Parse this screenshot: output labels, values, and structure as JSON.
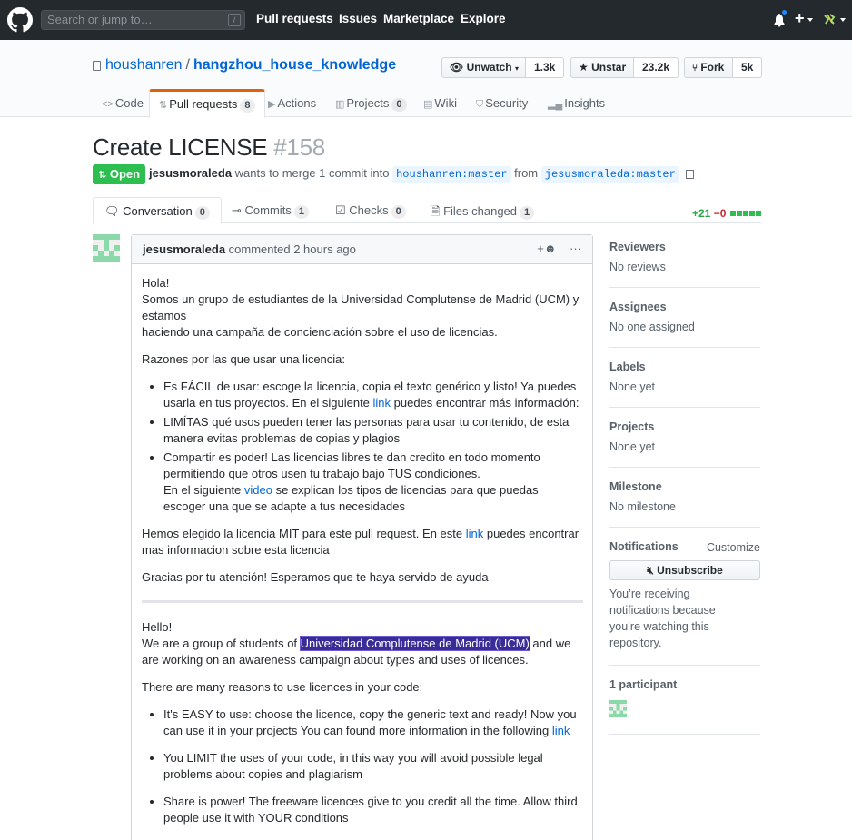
{
  "header": {
    "search_placeholder": "Search or jump to…",
    "search_key": "/",
    "nav": [
      "Pull requests",
      "Issues",
      "Marketplace",
      "Explore"
    ]
  },
  "repo": {
    "owner": "houshanren",
    "name": "hangzhou_house_knowledge",
    "watch_label": "Unwatch",
    "watch_count": "1.3k",
    "star_label": "Unstar",
    "star_count": "23.2k",
    "fork_label": "Fork",
    "fork_count": "5k",
    "tabs": [
      {
        "label": "Code",
        "icon": "code-icon"
      },
      {
        "label": "Pull requests",
        "count": "8",
        "icon": "pull-request-icon"
      },
      {
        "label": "Actions",
        "icon": "play-icon"
      },
      {
        "label": "Projects",
        "count": "0",
        "icon": "project-icon"
      },
      {
        "label": "Wiki",
        "icon": "book-icon"
      },
      {
        "label": "Security",
        "icon": "shield-icon"
      },
      {
        "label": "Insights",
        "icon": "graph-icon"
      }
    ]
  },
  "pr": {
    "title": "Create LICENSE",
    "number": "#158",
    "state": "Open",
    "author": "jesusmoraleda",
    "merge_text": "wants to merge 1 commit into",
    "base_branch": "houshanren:master",
    "from_text": "from",
    "head_branch": "jesusmoraleda:master",
    "tabs": [
      {
        "label": "Conversation",
        "count": "0"
      },
      {
        "label": "Commits",
        "count": "1"
      },
      {
        "label": "Checks",
        "count": "0"
      },
      {
        "label": "Files changed",
        "count": "1"
      }
    ],
    "additions": "+21",
    "deletions": "−0"
  },
  "comment": {
    "author": "jesusmoraleda",
    "action": "commented",
    "time": "2 hours ago",
    "es": {
      "greeting": "Hola!",
      "intro_1": "Somos un grupo de estudiantes de la Universidad Complutense de Madrid (UCM) y estamos",
      "intro_2": "haciendo una campaña de concienciación sobre el uso de licencias.",
      "reasons_title": "Razones por las que usar una licencia:",
      "b1_pre": "Es FÁCIL de usar: escoge la licencia, copia el texto genérico y listo! Ya puedes usarla en tus proyectos. En el siguiente ",
      "b1_link": "link",
      "b1_post": " puedes encontrar más información:",
      "b2": "LIMÍTAS qué usos pueden tener las personas para usar tu contenido, de esta manera evitas problemas de copias y plagios",
      "b3_1": "Compartir es poder! Las licencias libres te dan credito en todo momento permitiendo que otros usen tu trabajo bajo TUS condiciones.",
      "b3_pre": "En el siguiente ",
      "b3_link": "video",
      "b3_post": " se explican los tipos de licencias para que puedas escoger una que se adapte a tus necesidades",
      "mit_pre": "Hemos elegido la licencia MIT para este pull request. En este ",
      "mit_link": "link",
      "mit_post": " puedes encontrar mas informacion sobre esta licencia",
      "thanks": "Gracias por tu atención! Esperamos que te haya servido de ayuda"
    },
    "en": {
      "greeting": "Hello!",
      "intro_pre": "We are a group of students of ",
      "intro_hl": "Universidad Complutense de Madrid (UCM)",
      "intro_post": " and we are working on an awareness campaign about types and uses of licences.",
      "reasons_title": "There are many reasons to use licences in your code:",
      "b1_pre": "It's EASY to use: choose the licence, copy the generic text and ready! Now you can use it in your projects You can found more information in the following ",
      "b1_link": "link",
      "b2": "You LIMIT the uses of your code, in this way you will avoid possible legal problems about copies and plagiarism",
      "b3": "Share is power! The freeware licences give to you credit all the time. Allow third people use it with YOUR conditions"
    }
  },
  "sidebar": {
    "reviewers_title": "Reviewers",
    "reviewers_value": "No reviews",
    "assignees_title": "Assignees",
    "assignees_value": "No one assigned",
    "labels_title": "Labels",
    "labels_value": "None yet",
    "projects_title": "Projects",
    "projects_value": "None yet",
    "milestone_title": "Milestone",
    "milestone_value": "No milestone",
    "notifications_title": "Notifications",
    "customize": "Customize",
    "unsubscribe": "Unsubscribe",
    "reason": "You’re receiving notifications because you’re watching this repository.",
    "participants": "1 participant"
  },
  "colors": {
    "header_bg": "#24292e",
    "open_green": "#2cbe4e",
    "link_blue": "#0366d6",
    "tab_orange": "#e36209"
  }
}
